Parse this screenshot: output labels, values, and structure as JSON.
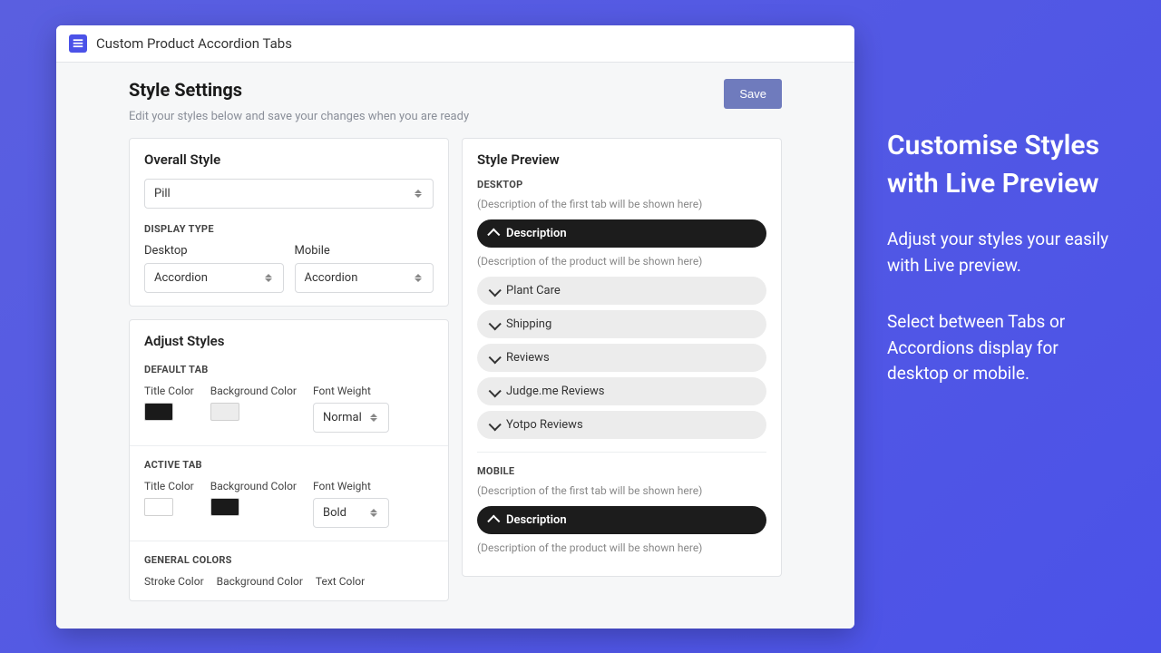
{
  "header": {
    "app_title": "Custom Product Accordion Tabs"
  },
  "page": {
    "title": "Style Settings",
    "subtitle": "Edit your styles below and save your changes when you are ready",
    "save_label": "Save"
  },
  "overall": {
    "title": "Overall Style",
    "style_value": "Pill",
    "display_type_label": "DISPLAY TYPE",
    "desktop_label": "Desktop",
    "mobile_label": "Mobile",
    "desktop_value": "Accordion",
    "mobile_value": "Accordion"
  },
  "adjust": {
    "title": "Adjust Styles",
    "default_tab_label": "DEFAULT TAB",
    "active_tab_label": "ACTIVE TAB",
    "title_color_label": "Title Color",
    "bg_color_label": "Background Color",
    "font_weight_label": "Font Weight",
    "default_font_weight_value": "Normal",
    "active_font_weight_value": "Bold",
    "default_title_color": "#1a1a1a",
    "default_bg_color": "#ececec",
    "active_title_color": "#ffffff",
    "active_bg_color": "#1a1a1a",
    "general_colors_label": "GENERAL COLORS",
    "stroke_color_label": "Stroke Color",
    "gen_bg_color_label": "Background Color",
    "text_color_label": "Text Color"
  },
  "preview": {
    "title": "Style Preview",
    "desktop_label": "DESKTOP",
    "mobile_label": "MOBILE",
    "first_tab_note": "(Description of the first tab will be shown here)",
    "product_note": "(Description of the product will be shown here)",
    "items": [
      {
        "label": "Description",
        "active": true
      },
      {
        "label": "Plant Care",
        "active": false
      },
      {
        "label": "Shipping",
        "active": false
      },
      {
        "label": "Reviews",
        "active": false
      },
      {
        "label": "Judge.me Reviews",
        "active": false
      },
      {
        "label": "Yotpo Reviews",
        "active": false
      }
    ],
    "mobile_items": [
      {
        "label": "Description",
        "active": true
      }
    ]
  },
  "sidebar": {
    "heading": "Customise Styles with Live Preview",
    "p1": "Adjust your styles your easily with Live preview.",
    "p2": "Select between Tabs or Accordions display for desktop or mobile."
  }
}
